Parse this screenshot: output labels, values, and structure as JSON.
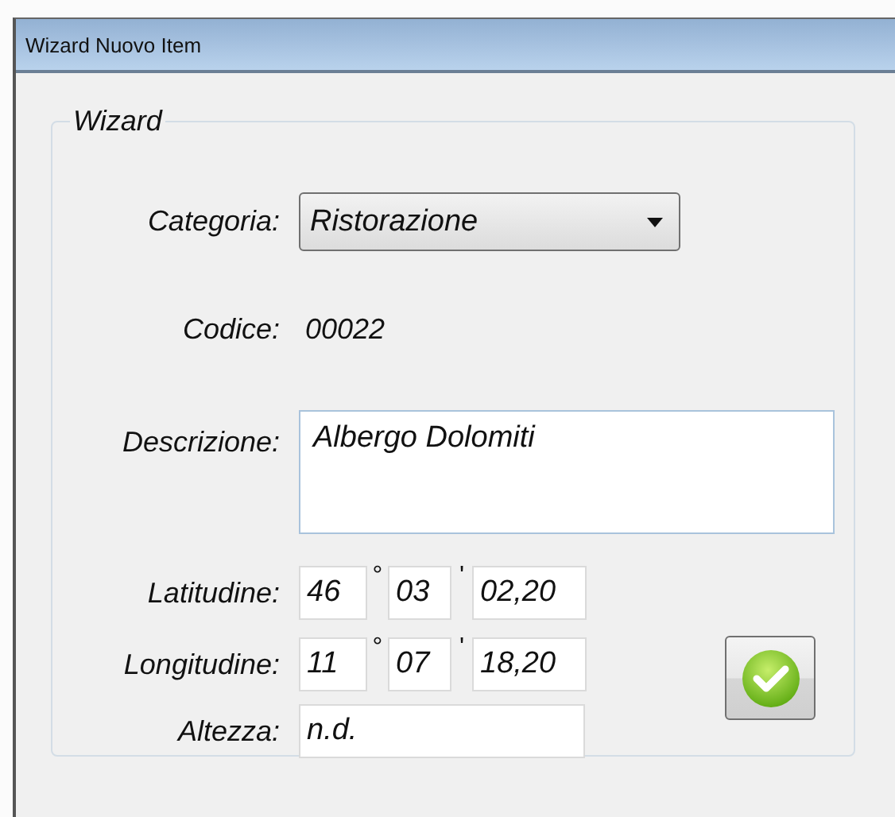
{
  "window": {
    "title": "Wizard Nuovo Item"
  },
  "group": {
    "title": "Wizard"
  },
  "category": {
    "label": "Categoria:",
    "value": "Ristorazione"
  },
  "code": {
    "label": "Codice:",
    "value": "00022"
  },
  "description": {
    "label": "Descrizione:",
    "value": "Albergo Dolomiti"
  },
  "coordinates": [
    {
      "label": "Latitudine:",
      "degrees": "46",
      "degree_mark": "°",
      "minutes": "03",
      "minute_mark": "'",
      "seconds": "02,20"
    },
    {
      "label": "Longitudine:",
      "degrees": "11",
      "degree_mark": "°",
      "minutes": "07",
      "minute_mark": "'",
      "seconds": "18,20"
    }
  ],
  "altitude": {
    "label": "Altezza:",
    "value": "n.d."
  },
  "confirm_button": {
    "kind": "ok"
  }
}
